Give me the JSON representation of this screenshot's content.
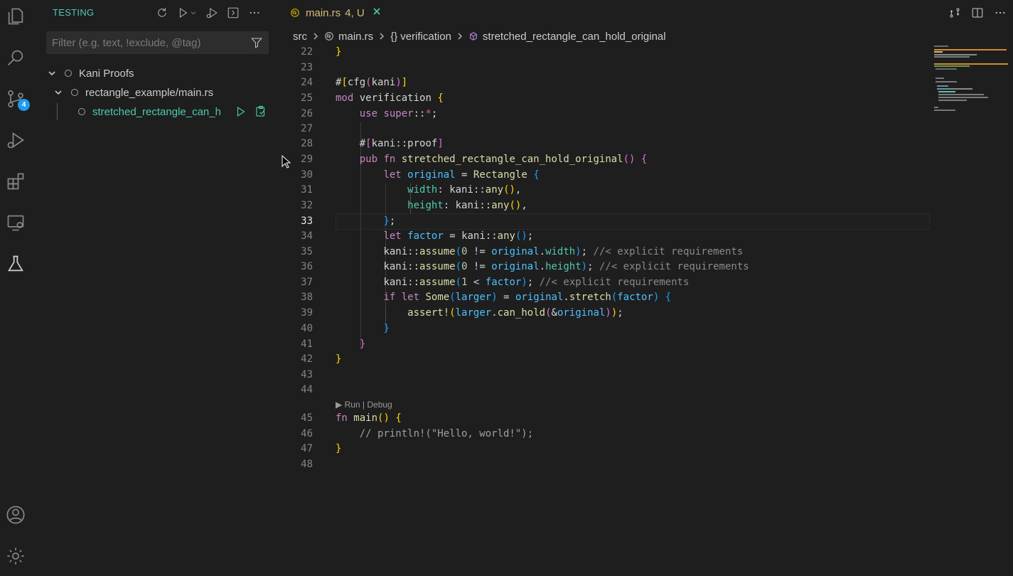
{
  "activity_bar": {
    "items": [
      {
        "name": "explorer-icon"
      },
      {
        "name": "search-icon"
      },
      {
        "name": "source-control-icon",
        "badge": "4"
      },
      {
        "name": "run-debug-icon"
      },
      {
        "name": "extensions-icon"
      },
      {
        "name": "remote-explorer-icon"
      },
      {
        "name": "testing-icon",
        "active": true
      }
    ],
    "bottom": [
      {
        "name": "account-icon"
      },
      {
        "name": "settings-gear-icon"
      }
    ]
  },
  "sidebar": {
    "title": "TESTING",
    "filter_placeholder": "Filter (e.g. text, !exclude, @tag)",
    "tree": {
      "root": "Kani Proofs",
      "file": "rectangle_example/main.rs",
      "test": "stretched_rectangle_can_h"
    }
  },
  "editor": {
    "tab": {
      "name": "main.rs",
      "status": "4, U"
    },
    "breadcrumb": {
      "folder": "src",
      "file": "main.rs",
      "module": "verification",
      "symbol": "stretched_rectangle_can_hold_original"
    },
    "code_lens": "▶ Run | Debug",
    "current_line": "33",
    "line_numbers": [
      "22",
      "23",
      "24",
      "25",
      "26",
      "27",
      "28",
      "29",
      "30",
      "31",
      "32",
      "33",
      "34",
      "35",
      "36",
      "37",
      "38",
      "39",
      "40",
      "41",
      "42",
      "43",
      "44",
      "45",
      "46",
      "47",
      "48"
    ]
  },
  "colors": {
    "accent": "#4ec9b0",
    "badge": "#1e9bf0",
    "modified": "#d7ba7d"
  }
}
